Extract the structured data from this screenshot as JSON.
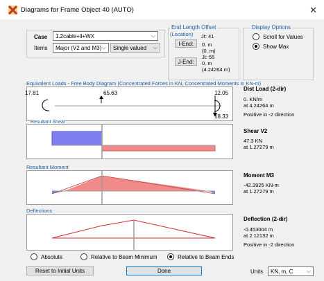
{
  "window": {
    "title": "Diagrams for Frame Object 40  (AUTO)",
    "close_glyph": "✕",
    "app_icon": "etabs-icon"
  },
  "case": {
    "label": "Case",
    "value": "1.2cable+ll+WX"
  },
  "items": {
    "label": "Items",
    "component_value": "Major (V2 and M3)",
    "mode_value": "Single valued"
  },
  "end_offset": {
    "title": "End Length Offset",
    "location": "(Location)",
    "i_end_button": "I-End:",
    "i_jt": "Jt: 41",
    "i_val": "0. m",
    "i_loc": "(0. m)",
    "j_end_button": "J-End:",
    "j_jt": "Jt: 55",
    "j_val": "0. m",
    "j_loc": "(4.24264 m)"
  },
  "display_options": {
    "title": "Display Options",
    "scroll": "Scroll for Values",
    "show_max": "Show Max",
    "selected": "Show Max"
  },
  "fbd": {
    "title": "Equivalent Loads - Free Body Diagram  (Concentrated Forces in KN, Concentrated Moments in KN-m)",
    "left_moment": "17.81",
    "mid_force": "65.63",
    "right_moment": "12.05",
    "right_force": "18.33",
    "result_title": "Dist Load (2-dir)",
    "result_value": "0. KN/m",
    "result_at": "at 4.24264 m",
    "result_note": "Positive in -2 direction"
  },
  "shear": {
    "title": "Resultant Shear",
    "result_title": "Shear V2",
    "result_value": "47.3 KN",
    "result_at": "at 1.27279 m"
  },
  "moment": {
    "title": "Resultant Moment",
    "result_title": "Moment M3",
    "result_value": "-42.3925 KN-m",
    "result_at": "at 1.27279 m"
  },
  "deflection": {
    "title": "Deflections",
    "result_title": "Deflection (2-dir)",
    "result_value": "-0.453004 m",
    "result_at": "at 2.12132 m",
    "result_note": "Positive in -2 direction"
  },
  "scale_options": {
    "absolute": "Absolute",
    "relative_min": "Relative to Beam Minimum",
    "relative_ends": "Relative to Beam Ends",
    "selected": "Relative to Beam Ends"
  },
  "buttons": {
    "reset": "Reset to Initial Units",
    "done": "Done"
  },
  "units": {
    "label": "Units",
    "value": "KN, m, C"
  },
  "colors": {
    "positive_fill": "#f08a8a",
    "negative_fill": "#7f7ff0",
    "axis": "#9a9a9a",
    "deflection_line": "#d22b2b",
    "group_title": "#1f5fa8"
  }
}
